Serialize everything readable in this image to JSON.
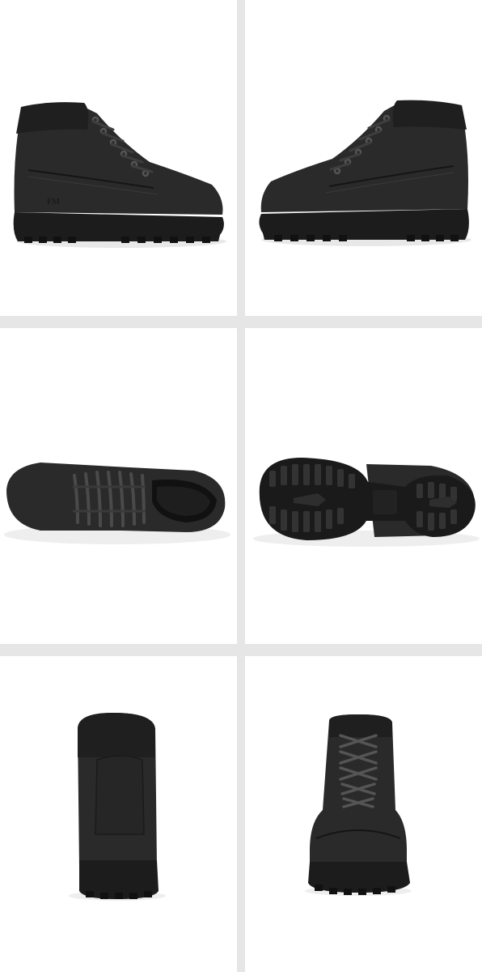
{
  "gallery": {
    "background_color": "#e6e6e6",
    "panel_color": "#ffffff",
    "boot_color": "#2a2a2a",
    "sole_color": "#1c1c1c",
    "lace_color": "#444444",
    "panels": [
      {
        "view": "side-left",
        "brand_mark": "FM"
      },
      {
        "view": "side-right"
      },
      {
        "view": "top"
      },
      {
        "view": "sole"
      },
      {
        "view": "back"
      },
      {
        "view": "front"
      }
    ]
  }
}
